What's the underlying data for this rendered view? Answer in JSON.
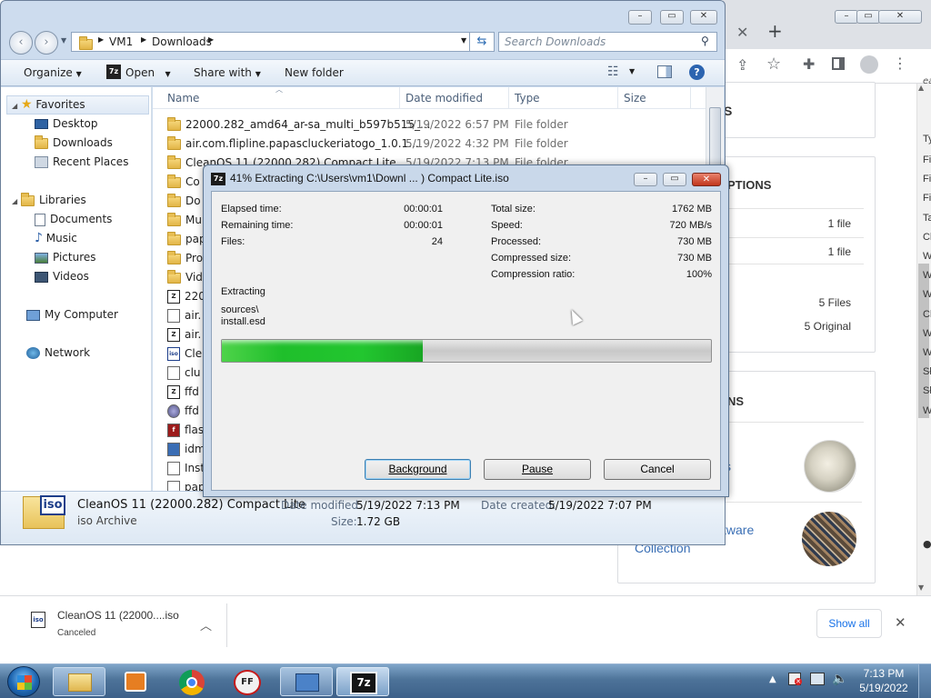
{
  "explorer": {
    "address": {
      "seg1": "VM1",
      "seg2": "Downloads"
    },
    "search_placeholder": "Search Downloads",
    "cmd": {
      "organize": "Organize",
      "open": "Open",
      "share": "Share with",
      "newfolder": "New folder"
    },
    "nav": {
      "favorites": "Favorites",
      "desktop": "Desktop",
      "downloads": "Downloads",
      "recent": "Recent Places",
      "libraries": "Libraries",
      "documents": "Documents",
      "music": "Music",
      "pictures": "Pictures",
      "videos": "Videos",
      "mycomputer": "My Computer",
      "network": "Network"
    },
    "columns": {
      "name": "Name",
      "date": "Date modified",
      "type": "Type",
      "size": "Size"
    },
    "files": [
      {
        "name": "22000.282_amd64_ar-sa_multi_b597b515_...",
        "date": "5/19/2022 6:57 PM",
        "type": "File folder",
        "icon": "folder-icon"
      },
      {
        "name": "air.com.flipline.papascluckeriatogo_1.0.1...",
        "date": "5/19/2022 4:32 PM",
        "type": "File folder",
        "icon": "folder-icon"
      },
      {
        "name": "CleanOS 11 (22000.282) Compact Lite",
        "date": "5/19/2022 7:13 PM",
        "type": "File folder",
        "icon": "folder-icon"
      },
      {
        "name": "Co",
        "icon": "folder-icon"
      },
      {
        "name": "Do",
        "icon": "folder-icon"
      },
      {
        "name": "Mu",
        "icon": "folder-icon"
      },
      {
        "name": "pap",
        "icon": "folder-icon"
      },
      {
        "name": "Pro",
        "icon": "folder-icon"
      },
      {
        "name": "Vid",
        "icon": "folder-icon"
      },
      {
        "name": "220",
        "icon": "7z-archive-icon"
      },
      {
        "name": "air.",
        "icon": "file-icon"
      },
      {
        "name": "air.",
        "icon": "7z-archive-icon"
      },
      {
        "name": "Cle",
        "icon": "iso-icon"
      },
      {
        "name": "clu",
        "icon": "file-icon"
      },
      {
        "name": "ffd",
        "icon": "7z-archive-icon"
      },
      {
        "name": "ffd",
        "icon": "globe-icon"
      },
      {
        "name": "flas",
        "icon": "flash-icon"
      },
      {
        "name": "idm",
        "icon": "installer-icon"
      },
      {
        "name": "Inst",
        "icon": "file-icon"
      },
      {
        "name": "pap",
        "icon": "file-icon"
      }
    ],
    "details": {
      "filename": "CleanOS 11 (22000.282) Compact Lite",
      "filetype": "iso Archive",
      "date_modified_label": "Date modified:",
      "date_modified": "5/19/2022 7:13 PM",
      "date_created_label": "Date created:",
      "date_created": "5/19/2022 7:07 PM",
      "size_label": "Size:",
      "size": "1.72 GB",
      "iso_label": "iso"
    }
  },
  "dialog": {
    "title": "41% Extracting C:\\Users\\vm1\\Downl ... ) Compact Lite.iso",
    "progress_percent": 41,
    "stats_left": [
      {
        "label": "Elapsed time:",
        "value": "00:00:01"
      },
      {
        "label": "Remaining time:",
        "value": "00:00:01"
      },
      {
        "label": "Files:",
        "value": "24"
      }
    ],
    "stats_right": [
      {
        "label": "Total size:",
        "value": "1762 MB"
      },
      {
        "label": "Speed:",
        "value": "720 MB/s"
      },
      {
        "label": "Processed:",
        "value": "730 MB"
      },
      {
        "label": "Compressed size:",
        "value": "730 MB"
      },
      {
        "label": "Compression ratio:",
        "value": "100%"
      }
    ],
    "extracting_label": "Extracting",
    "path_line1": "sources\\",
    "path_line2": "install.esd",
    "buttons": {
      "background": "Background",
      "pause": "Pause",
      "cancel": "Cancel"
    }
  },
  "chrome": {
    "heading1": "S",
    "heading2": "PTIONS",
    "row1": "1 file",
    "row2": "1 file",
    "row3": "5 Files",
    "row4": "5 Original",
    "heading3": "NS",
    "link1": "s",
    "link2a": "tware",
    "link2b": "Collection",
    "side_letters": [
      "Ty",
      "Fi",
      "Fi",
      "Fi",
      "Ta",
      "Cl",
      "W",
      "W",
      "W",
      "Cl",
      "W",
      "W",
      "Sł",
      "Sł",
      "W"
    ],
    "side_top": "ea",
    "download": {
      "name": "CleanOS 11 (22000....iso",
      "status": "Canceled",
      "show_all": "Show all"
    }
  },
  "taskbar": {
    "time": "7:13 PM",
    "date": "5/19/2022"
  }
}
